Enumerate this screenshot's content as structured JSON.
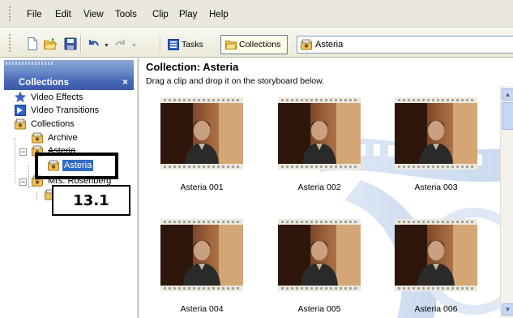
{
  "menu": {
    "items": [
      "File",
      "Edit",
      "View",
      "Tools",
      "Clip",
      "Play",
      "Help"
    ]
  },
  "toolbar": {
    "tasks_label": "Tasks",
    "collections_label": "Collections",
    "collection_select_value": "Asteria",
    "icons": [
      "new-project-icon",
      "open-project-icon",
      "save-project-icon",
      "undo-icon",
      "redo-icon"
    ]
  },
  "panel": {
    "title": "Collections",
    "close_glyph": "×",
    "tree": [
      {
        "label": "Video Effects",
        "icon": "video-effects-icon",
        "level": 0
      },
      {
        "label": "Video Transitions",
        "icon": "video-transitions-icon",
        "level": 0
      },
      {
        "label": "Collections",
        "icon": "collections-icon",
        "level": 0
      },
      {
        "label": "Archive",
        "icon": "collection-icon",
        "level": 1
      },
      {
        "label": "Asteria",
        "icon": "collection-icon",
        "level": 1,
        "expanded": true
      },
      {
        "label": "Asteria",
        "icon": "collection-icon",
        "level": 2,
        "selected": true
      },
      {
        "label": "Mrs. Rosenberg",
        "icon": "collection-icon",
        "level": 1,
        "expanded": true
      }
    ]
  },
  "annotation": {
    "label": "13.1"
  },
  "content": {
    "heading": "Collection: Asteria",
    "instruction": "Drag a clip and drop it on the storyboard below.",
    "clips": [
      "Asteria 001",
      "Asteria 002",
      "Asteria 003",
      "Asteria 004",
      "Asteria 005",
      "Asteria 006"
    ]
  },
  "colors": {
    "selection": "#316ac5",
    "panel_header": "#4667b6",
    "menubar": "#eae8dc",
    "scrollbar": "#c8d6f5"
  }
}
